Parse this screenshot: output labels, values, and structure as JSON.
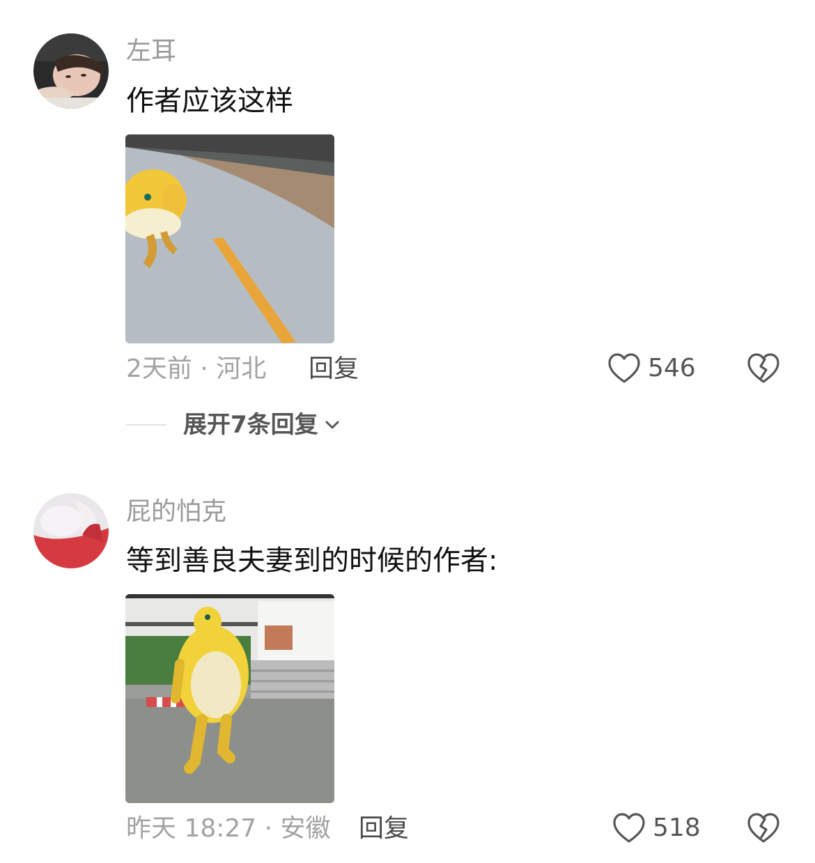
{
  "comments": [
    {
      "username": "左耳",
      "text": "作者应该这样",
      "meta": "2天前 · 河北",
      "reply_label": "回复",
      "likes": "546",
      "expand_label": "展开7条回复",
      "avatar_icon": "user-avatar-photo",
      "media_icon": "gif-yellow-mascot-walking-road"
    },
    {
      "username": "屁的怕克",
      "text": "等到善良夫妻到的时候的作者:",
      "meta": "昨天 18:27 · 安徽",
      "reply_label": "回复",
      "likes": "518",
      "avatar_icon": "user-avatar-photo",
      "media_icon": "gif-yellow-mascot-walking-street"
    }
  ],
  "colors": {
    "username": "#9a9a9a",
    "text": "#111111",
    "meta": "#a2a2a2",
    "action": "#4a4a4a",
    "icon": "#555555"
  }
}
